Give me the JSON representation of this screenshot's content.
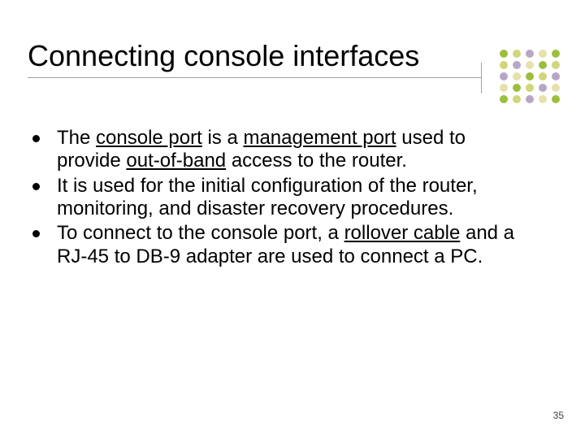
{
  "title": "Connecting console interfaces",
  "bullets": [
    {
      "runs": [
        {
          "t": "The "
        },
        {
          "t": "console port",
          "u": true
        },
        {
          "t": " is a "
        },
        {
          "t": "management port",
          "u": true
        },
        {
          "t": " used to provide "
        },
        {
          "t": "out-of-band",
          "u": true
        },
        {
          "t": " access to the router."
        }
      ]
    },
    {
      "runs": [
        {
          "t": "It is used for the initial configuration of the router, monitoring, and disaster recovery procedures."
        }
      ]
    },
    {
      "runs": [
        {
          "t": "To connect to the console port, a "
        },
        {
          "t": "rollover cable",
          "u": true
        },
        {
          "t": " and a RJ-45 to DB-9 adapter are used to connect a PC."
        }
      ]
    }
  ],
  "page_number": "35",
  "deco_colors": {
    "c1": "#9bbf3c",
    "c2": "#d0d67a",
    "c3": "#b8a6c6",
    "c4": "#e6e1aa"
  }
}
